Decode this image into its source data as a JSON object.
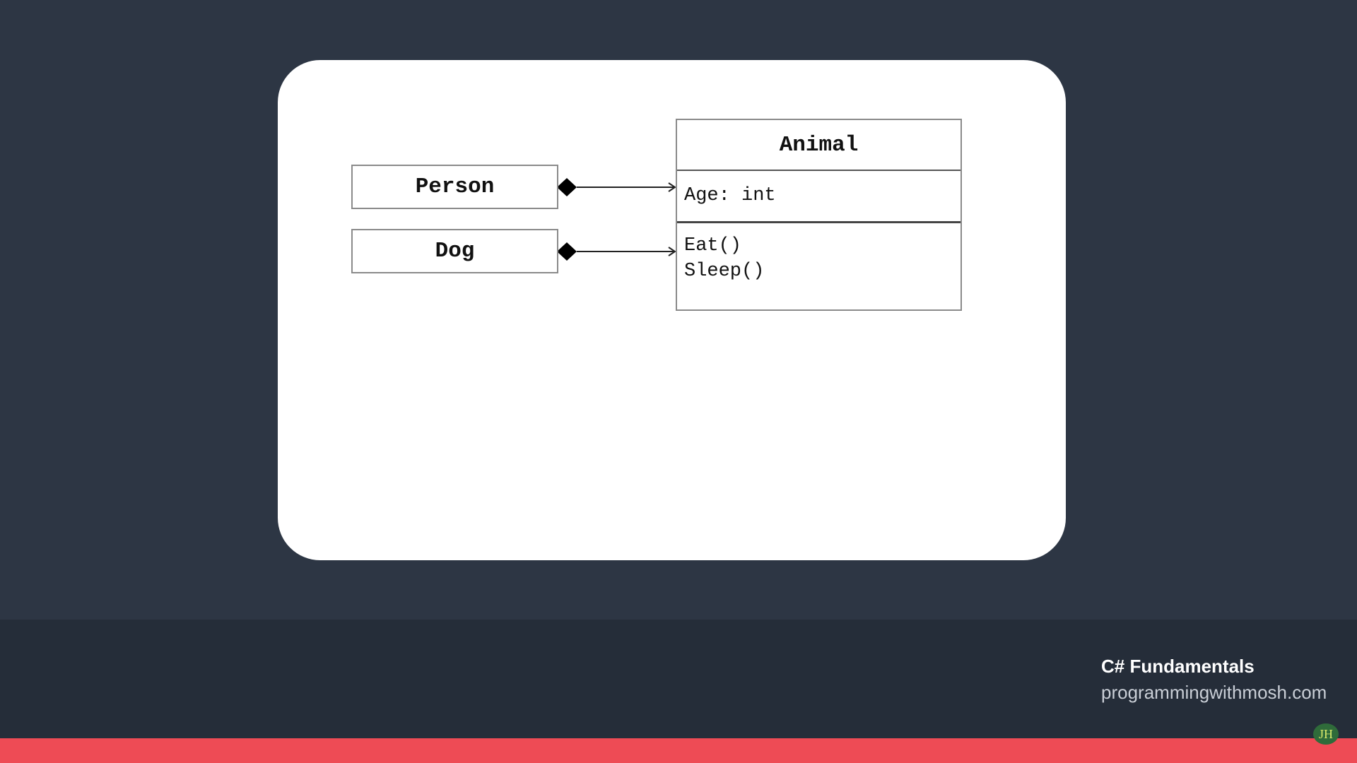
{
  "diagram": {
    "classes": {
      "person": {
        "name": "Person"
      },
      "dog": {
        "name": "Dog"
      },
      "animal": {
        "name": "Animal",
        "attributes": [
          "Age: int"
        ],
        "methods": [
          "Eat()",
          "Sleep()"
        ]
      }
    },
    "relations": [
      {
        "from": "Person",
        "to": "Animal",
        "type": "composition"
      },
      {
        "from": "Dog",
        "to": "Animal",
        "type": "composition"
      }
    ]
  },
  "footer": {
    "course_title": "C# Fundamentals",
    "course_site": "programmingwithmosh.com",
    "watermark": "JH"
  },
  "colors": {
    "background": "#2d3644",
    "footer_band": "#252d39",
    "accent_bar": "#ee4b55",
    "slide": "#ffffff"
  }
}
